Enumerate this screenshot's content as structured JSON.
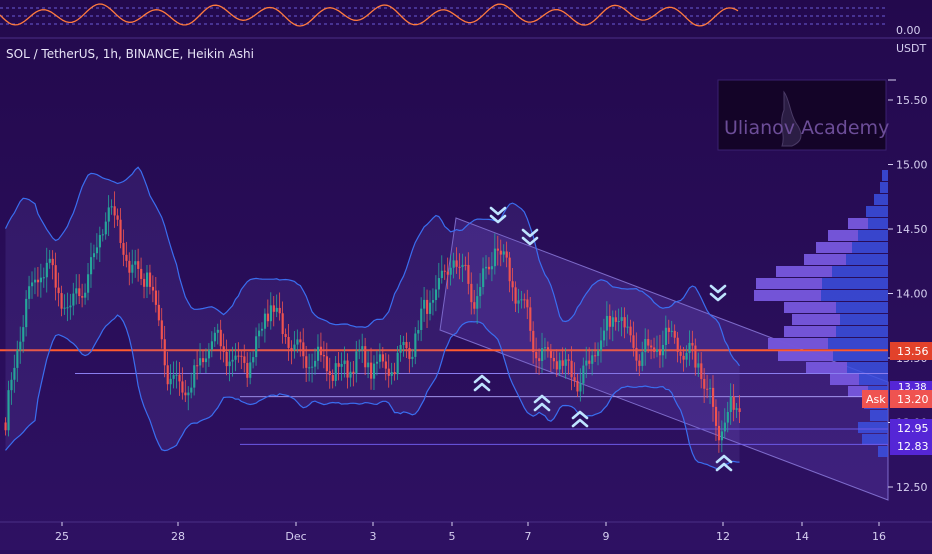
{
  "header": {
    "symbol_title": "SOL / TetherUS, 1h, BINANCE, Heikin Ashi",
    "osc_value": "0.00",
    "currency": "USDT"
  },
  "watermark": {
    "text": "Ulianov Academy"
  },
  "price_badges": {
    "level_1": "13.56",
    "level_2": "13.38",
    "ask_label": "Ask",
    "ask_price": "13.20",
    "level_3": "12.95",
    "level_4": "12.83"
  },
  "chart_data": {
    "type": "candlestick",
    "title": "SOL / TetherUS, 1h, BINANCE, Heikin Ashi",
    "x_ticks": [
      "25",
      "28",
      "Dec",
      "3",
      "5",
      "7",
      "9",
      "12",
      "14",
      "16"
    ],
    "y_ticks": [
      15.5,
      15.0,
      14.5,
      14.0,
      13.5,
      13.0,
      12.5
    ],
    "ylim": [
      12.32,
      15.72
    ],
    "horizontal_levels": [
      13.56,
      13.38,
      13.2,
      12.95,
      12.83
    ],
    "key_level": 13.56,
    "close_approx": [
      [
        "Nov 24",
        13.0
      ],
      [
        "Nov 24",
        13.9
      ],
      [
        "Nov 25",
        14.3
      ],
      [
        "Nov 25",
        13.8
      ],
      [
        "Nov 26",
        14.1
      ],
      [
        "Nov 26",
        14.7
      ],
      [
        "Nov 27",
        14.2
      ],
      [
        "Nov 27",
        14.2
      ],
      [
        "Nov 28",
        13.3
      ],
      [
        "Nov 28",
        13.3
      ],
      [
        "Nov 29",
        13.6
      ],
      [
        "Nov 30",
        13.5
      ],
      [
        "Nov 30",
        13.5
      ],
      [
        "Dec 1",
        13.9
      ],
      [
        "Dec 1",
        13.6
      ],
      [
        "Dec 2",
        13.5
      ],
      [
        "Dec 3",
        13.4
      ],
      [
        "Dec 4",
        13.5
      ],
      [
        "Dec 4",
        13.4
      ],
      [
        "Dec 5",
        13.5
      ],
      [
        "Dec 5",
        13.6
      ],
      [
        "Dec 5",
        14.0
      ],
      [
        "Dec 6",
        14.3
      ],
      [
        "Dec 6",
        13.9
      ],
      [
        "Dec 7",
        14.4
      ],
      [
        "Dec 7",
        14.0
      ],
      [
        "Dec 7",
        13.6
      ],
      [
        "Dec 8",
        13.5
      ],
      [
        "Dec 8",
        13.3
      ],
      [
        "Dec 9",
        13.6
      ],
      [
        "Dec 9",
        13.8
      ],
      [
        "Dec 10",
        13.6
      ],
      [
        "Dec 11",
        13.6
      ],
      [
        "Dec 11",
        13.6
      ],
      [
        "Dec 12",
        13.5
      ],
      [
        "Dec 12",
        12.9
      ],
      [
        "Dec 12",
        13.2
      ]
    ]
  }
}
